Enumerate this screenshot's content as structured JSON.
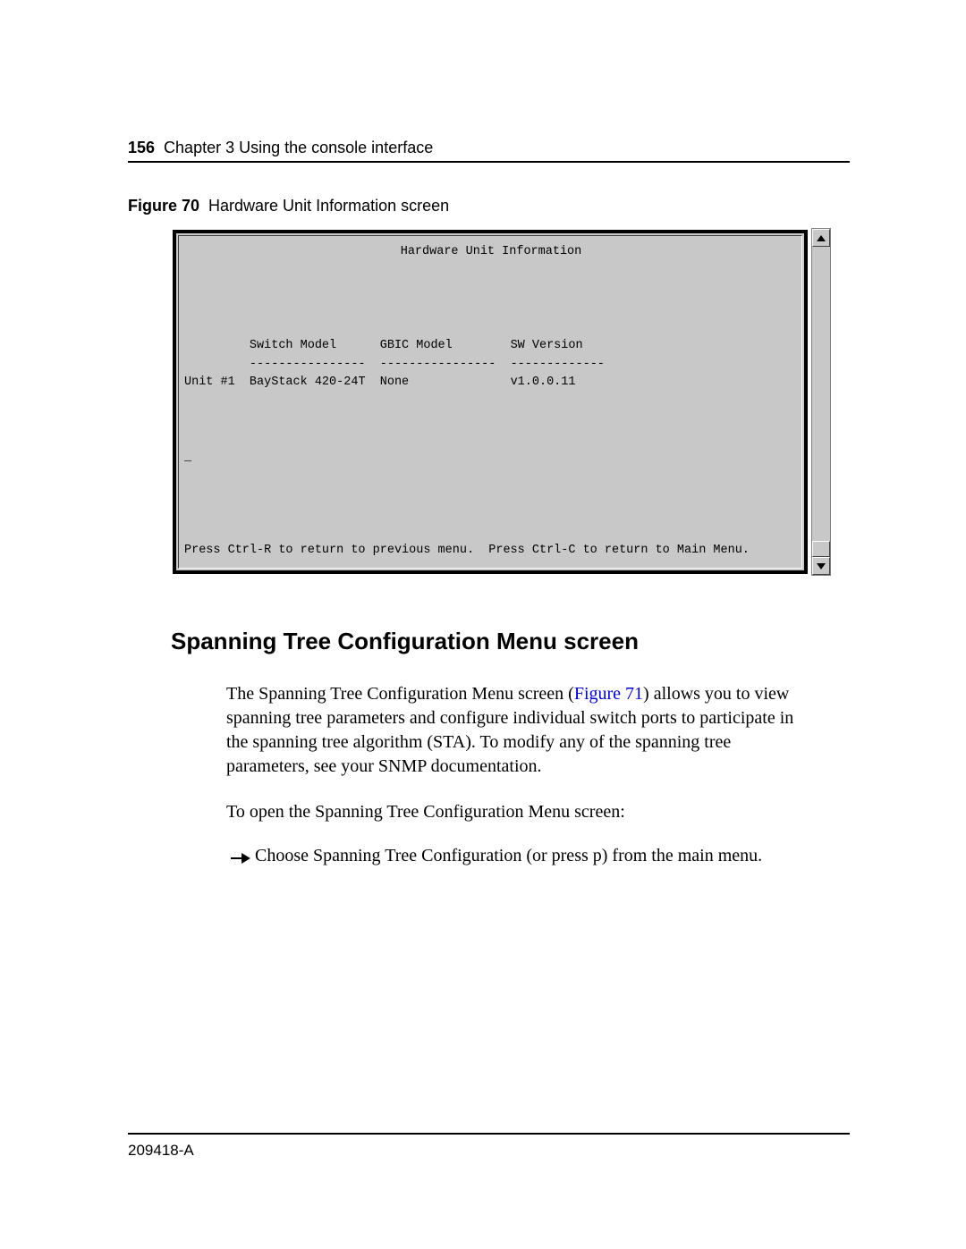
{
  "header": {
    "page_number": "156",
    "chapter_line": "Chapter 3  Using the console interface"
  },
  "figure": {
    "number": "Figure 70",
    "title": "Hardware Unit Information screen"
  },
  "console": {
    "title": "Hardware Unit Information",
    "columns": {
      "c1": "Switch Model",
      "c2": "GBIC Model",
      "c3": "SW Version"
    },
    "dividers": {
      "d1": "----------------",
      "d2": "----------------",
      "d3": "-------------"
    },
    "row": {
      "unit_label": "Unit #1",
      "switch_model": "BayStack 420-24T",
      "gbic_model": "None",
      "sw_version": "v1.0.0.11"
    },
    "cursor": "_",
    "footer": "Press Ctrl-R to return to previous menu.  Press Ctrl-C to return to Main Menu."
  },
  "section": {
    "heading": "Spanning Tree Configuration Menu screen",
    "para1_a": "The Spanning Tree Configuration Menu screen (",
    "figref": "Figure 71",
    "para1_b": ") allows you to view spanning tree parameters and configure individual switch ports to participate in the spanning tree algorithm (STA). To modify any of the spanning tree parameters, see your SNMP documentation.",
    "para2": "To open the Spanning Tree Configuration Menu screen:",
    "bullet": "Choose Spanning Tree Configuration (or press p) from the main menu."
  },
  "footer": {
    "docid": "209418-A"
  }
}
